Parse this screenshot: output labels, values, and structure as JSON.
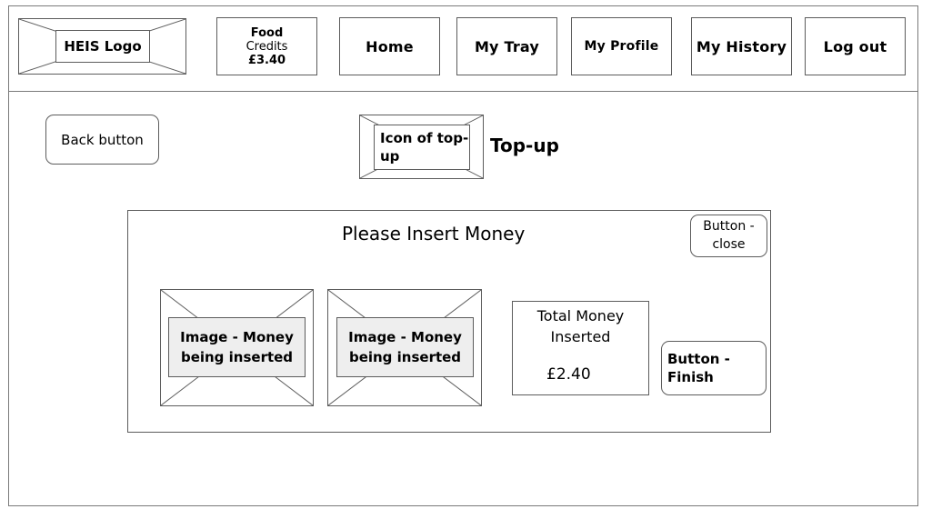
{
  "header": {
    "logo_label": "HEIS Logo",
    "credits": {
      "line1": "Food",
      "line2": "Credits",
      "amount": "£3.40"
    },
    "nav": {
      "home": "Home",
      "my_tray": "My Tray",
      "my_profile": "My Profile",
      "my_history": "My History",
      "log_out": "Log out"
    }
  },
  "page": {
    "back_button": "Back button",
    "topup_icon_label": "Icon of top-up",
    "title": "Top-up"
  },
  "dialog": {
    "title": "Please Insert Money",
    "close_button": "Button - close",
    "money_images": [
      "Image - Money being inserted",
      "Image - Money being inserted"
    ],
    "total_label": "Total Money Inserted",
    "total_amount": "£2.40",
    "finish_button": "Button - Finish"
  }
}
